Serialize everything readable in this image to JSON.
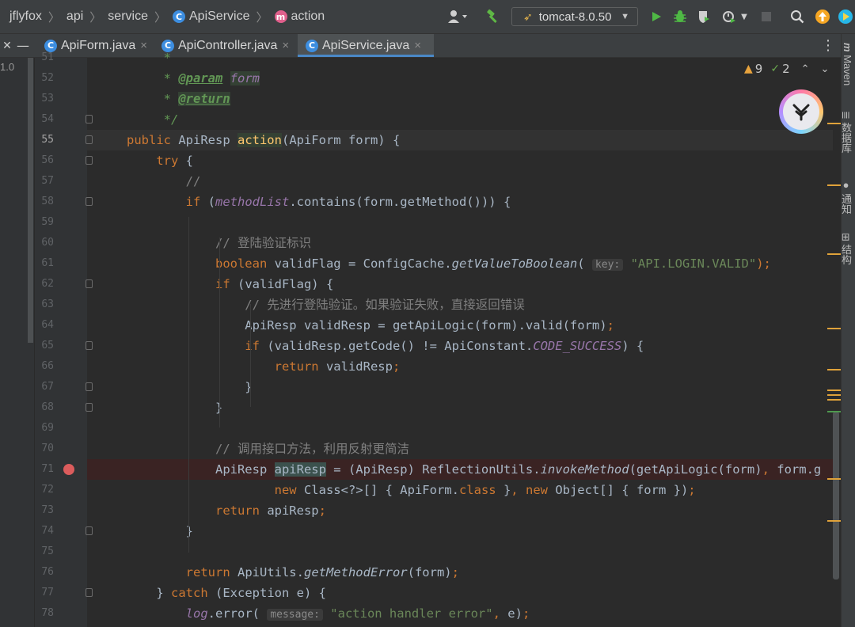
{
  "breadcrumbs": [
    "jflyfox",
    "api",
    "service",
    "ApiService",
    "action"
  ],
  "run_config": "tomcat-8.0.50",
  "tabs": [
    {
      "label": "ApiForm.java",
      "active": false
    },
    {
      "label": "ApiController.java",
      "active": false
    },
    {
      "label": "ApiService.java",
      "active": true
    }
  ],
  "left_panel_label": "1.0",
  "inspection": {
    "warnings": "9",
    "weak_warnings": "2"
  },
  "right_panel": [
    "Maven",
    "数据库",
    "通知",
    "结构"
  ],
  "colors": {
    "keyword": "#cc7832",
    "method": "#ffc66d",
    "string": "#6a8759",
    "comment": "#808080",
    "field": "#9876aa",
    "breakpoint": "#db5c5c",
    "accent": "#4a88c7"
  },
  "lines": [
    {
      "n": "51",
      "s": [
        {
          "t": "     *",
          "c": "doc"
        }
      ]
    },
    {
      "n": "52",
      "s": [
        {
          "t": "     * ",
          "c": "doc"
        },
        {
          "t": "@param",
          "c": "tag"
        },
        {
          "t": " ",
          "c": "doc"
        },
        {
          "t": "form",
          "c": "hl2 fld"
        }
      ]
    },
    {
      "n": "53",
      "s": [
        {
          "t": "     * ",
          "c": "doc"
        },
        {
          "t": "@return",
          "c": "tag hl2"
        }
      ]
    },
    {
      "n": "54",
      "s": [
        {
          "t": "     */",
          "c": "doc"
        }
      ]
    },
    {
      "n": "55",
      "s": [
        {
          "t": "public ",
          "c": "kw"
        },
        {
          "t": "ApiResp "
        },
        {
          "t": "action",
          "c": "fn hl2"
        },
        {
          "t": "(ApiForm form) {"
        }
      ]
    },
    {
      "n": "56",
      "s": [
        {
          "t": "    "
        },
        {
          "t": "try",
          "c": "kw"
        },
        {
          "t": " {"
        }
      ]
    },
    {
      "n": "57",
      "s": [
        {
          "t": "        //",
          "c": "cm"
        }
      ]
    },
    {
      "n": "58",
      "s": [
        {
          "t": "        "
        },
        {
          "t": "if",
          "c": "kw"
        },
        {
          "t": " ("
        },
        {
          "t": "methodList",
          "c": "fld"
        },
        {
          "t": ".contains(form.getMethod())) {"
        }
      ]
    },
    {
      "n": "59",
      "s": []
    },
    {
      "n": "60",
      "s": [
        {
          "t": "            // 登陆验证标识",
          "c": "cm"
        }
      ]
    },
    {
      "n": "61",
      "s": [
        {
          "t": "            "
        },
        {
          "t": "boolean",
          "c": "kw"
        },
        {
          "t": " validFlag = ConfigCache."
        },
        {
          "t": "getValueToBoolean",
          "c": "st"
        },
        {
          "t": "( "
        },
        {
          "t": "key:",
          "c": "hint"
        },
        {
          "t": " "
        },
        {
          "t": "\"API.LOGIN.VALID\"",
          "c": "str"
        },
        {
          "t": ");",
          "c": "kw"
        }
      ]
    },
    {
      "n": "62",
      "s": [
        {
          "t": "            "
        },
        {
          "t": "if",
          "c": "kw"
        },
        {
          "t": " (validFlag) {"
        }
      ]
    },
    {
      "n": "63",
      "s": [
        {
          "t": "                // 先进行登陆验证。如果验证失败，直接返回错误",
          "c": "cm"
        }
      ]
    },
    {
      "n": "64",
      "s": [
        {
          "t": "                ApiResp validResp = getApiLogic(form).valid(form)"
        },
        {
          "t": ";",
          "c": "kw"
        }
      ]
    },
    {
      "n": "65",
      "s": [
        {
          "t": "                "
        },
        {
          "t": "if",
          "c": "kw"
        },
        {
          "t": " (validResp.getCode() != ApiConstant."
        },
        {
          "t": "CODE_SUCCESS",
          "c": "fld"
        },
        {
          "t": ") {"
        }
      ]
    },
    {
      "n": "66",
      "s": [
        {
          "t": "                    "
        },
        {
          "t": "return",
          "c": "kw"
        },
        {
          "t": " validResp"
        },
        {
          "t": ";",
          "c": "kw"
        }
      ]
    },
    {
      "n": "67",
      "s": [
        {
          "t": "                }"
        }
      ]
    },
    {
      "n": "68",
      "s": [
        {
          "t": "            }"
        }
      ]
    },
    {
      "n": "69",
      "s": []
    },
    {
      "n": "70",
      "s": [
        {
          "t": "            // 调用接口方法，利用反射更简洁",
          "c": "cm"
        }
      ]
    },
    {
      "n": "71",
      "s": [
        {
          "t": "            ApiResp "
        },
        {
          "t": "apiResp",
          "c": "hl"
        },
        {
          "t": " = (ApiResp) ReflectionUtils."
        },
        {
          "t": "invokeMethod",
          "c": "st"
        },
        {
          "t": "(getApiLogic(form)"
        },
        {
          "t": ",",
          "c": "kw"
        },
        {
          "t": " form.g"
        }
      ]
    },
    {
      "n": "72",
      "s": [
        {
          "t": "                    "
        },
        {
          "t": "new",
          "c": "kw"
        },
        {
          "t": " Class<?>[] { ApiForm."
        },
        {
          "t": "class",
          "c": "kw"
        },
        {
          "t": " }"
        },
        {
          "t": ",",
          "c": "kw"
        },
        {
          "t": " "
        },
        {
          "t": "new",
          "c": "kw"
        },
        {
          "t": " Object[] { form })"
        },
        {
          "t": ";",
          "c": "kw"
        }
      ]
    },
    {
      "n": "73",
      "s": [
        {
          "t": "            "
        },
        {
          "t": "return",
          "c": "kw"
        },
        {
          "t": " apiResp"
        },
        {
          "t": ";",
          "c": "kw"
        }
      ]
    },
    {
      "n": "74",
      "s": [
        {
          "t": "        }"
        }
      ]
    },
    {
      "n": "75",
      "s": []
    },
    {
      "n": "76",
      "s": [
        {
          "t": "        "
        },
        {
          "t": "return",
          "c": "kw"
        },
        {
          "t": " ApiUtils."
        },
        {
          "t": "getMethodError",
          "c": "st"
        },
        {
          "t": "(form)"
        },
        {
          "t": ";",
          "c": "kw"
        }
      ]
    },
    {
      "n": "77",
      "s": [
        {
          "t": "    } "
        },
        {
          "t": "catch",
          "c": "kw"
        },
        {
          "t": " (Exception e) {"
        }
      ]
    },
    {
      "n": "78",
      "s": [
        {
          "t": "        "
        },
        {
          "t": "log",
          "c": "fld"
        },
        {
          "t": ".error( "
        },
        {
          "t": "message:",
          "c": "hint"
        },
        {
          "t": " "
        },
        {
          "t": "\"action handler error\"",
          "c": "str"
        },
        {
          "t": ",",
          "c": "kw"
        },
        {
          "t": " e)"
        },
        {
          "t": ";",
          "c": "kw"
        }
      ]
    }
  ]
}
